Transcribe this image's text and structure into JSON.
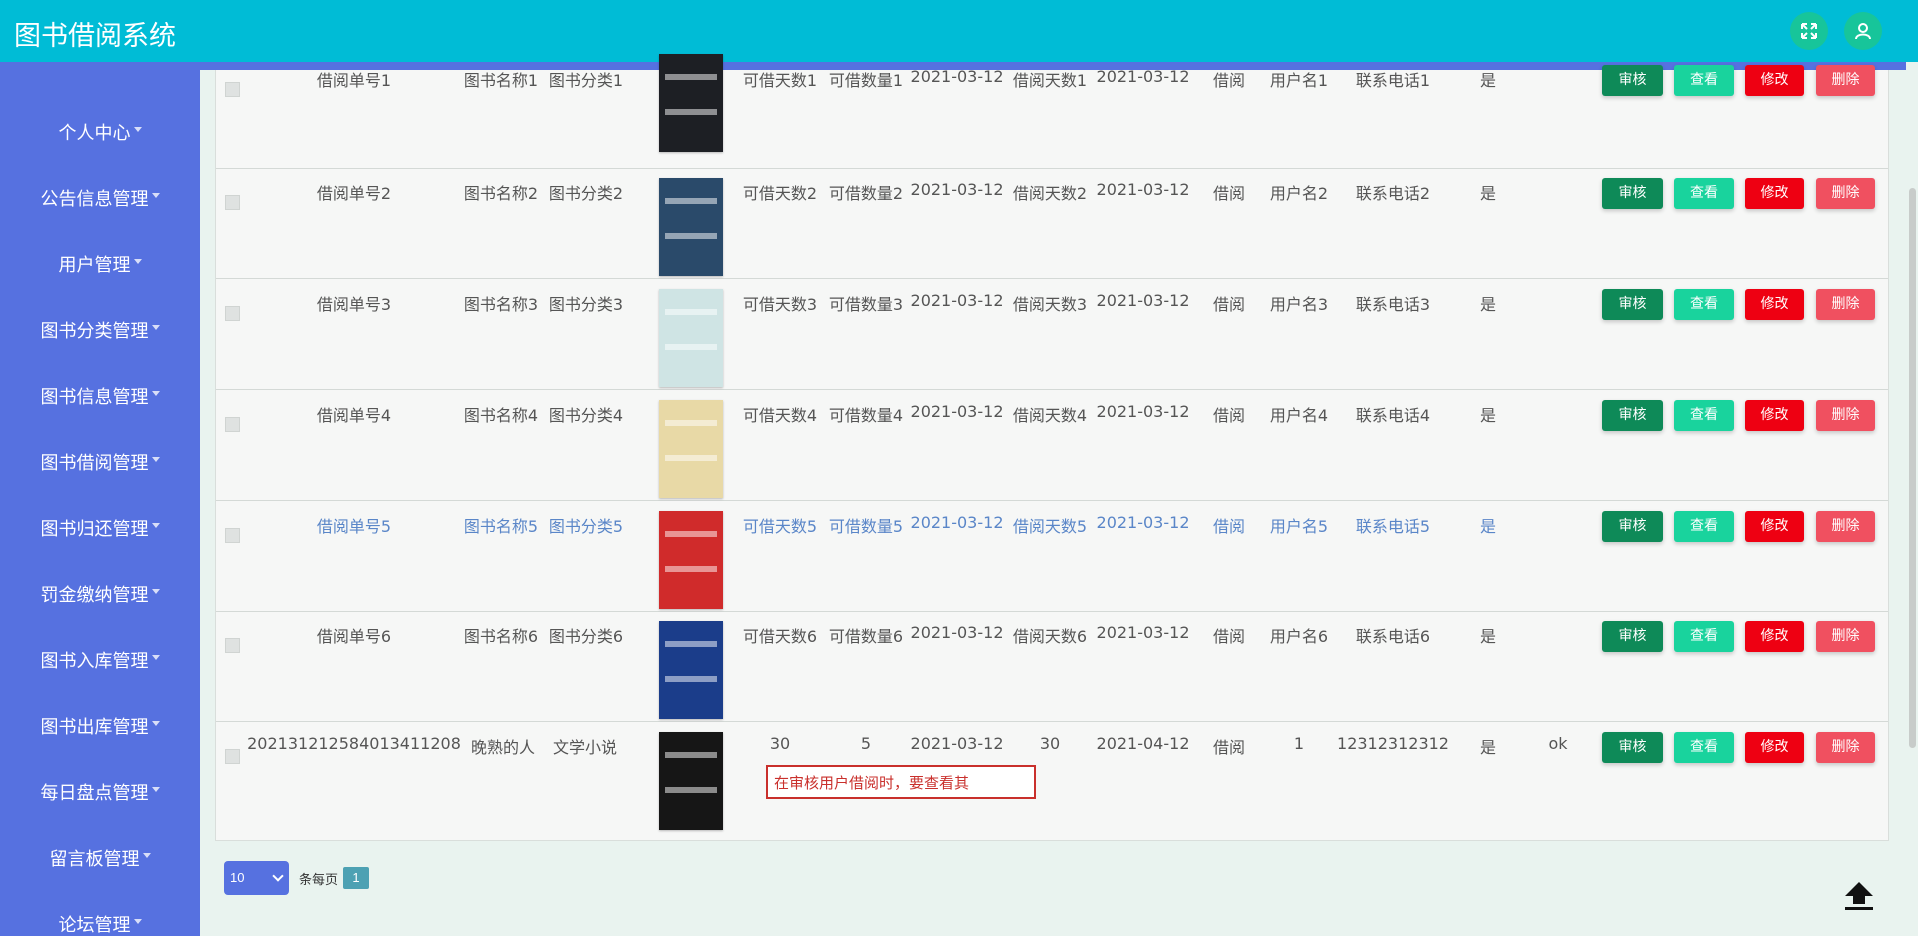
{
  "app": {
    "title": "图书借阅系统"
  },
  "header": {
    "icons": [
      "expand-icon",
      "user-icon"
    ],
    "accent": "#00bcd6"
  },
  "sidebar": {
    "items": [
      {
        "label": "个人中心"
      },
      {
        "label": "公告信息管理"
      },
      {
        "label": "用户管理"
      },
      {
        "label": "图书分类管理"
      },
      {
        "label": "图书信息管理"
      },
      {
        "label": "图书借阅管理"
      },
      {
        "label": "图书归还管理"
      },
      {
        "label": "罚金缴纳管理"
      },
      {
        "label": "图书入库管理"
      },
      {
        "label": "图书出库管理"
      },
      {
        "label": "每日盘点管理"
      },
      {
        "label": "留言板管理"
      },
      {
        "label": "论坛管理"
      }
    ]
  },
  "actions": {
    "audit": "审核",
    "view": "查看",
    "edit": "修改",
    "delete": "删除"
  },
  "rows": [
    {
      "no": "借阅单号1",
      "name": "图书名称1",
      "cat": "图书分类1",
      "days_avail": "可借天数1",
      "qty": "可借数量1",
      "date1": "2021-03-12",
      "days_borrow": "借阅天数1",
      "date2": "2021-03-12",
      "status": "借阅",
      "user": "用户名1",
      "phone": "联系电话1",
      "flag": "是",
      "remark": "",
      "cover_color": "#1d1f24"
    },
    {
      "no": "借阅单号2",
      "name": "图书名称2",
      "cat": "图书分类2",
      "days_avail": "可借天数2",
      "qty": "可借数量2",
      "date1": "2021-03-12",
      "days_borrow": "借阅天数2",
      "date2": "2021-03-12",
      "status": "借阅",
      "user": "用户名2",
      "phone": "联系电话2",
      "flag": "是",
      "remark": "",
      "cover_color": "#2a4a6a"
    },
    {
      "no": "借阅单号3",
      "name": "图书名称3",
      "cat": "图书分类3",
      "days_avail": "可借天数3",
      "qty": "可借数量3",
      "date1": "2021-03-12",
      "days_borrow": "借阅天数3",
      "date2": "2021-03-12",
      "status": "借阅",
      "user": "用户名3",
      "phone": "联系电话3",
      "flag": "是",
      "remark": "",
      "cover_color": "#cfe4e4"
    },
    {
      "no": "借阅单号4",
      "name": "图书名称4",
      "cat": "图书分类4",
      "days_avail": "可借天数4",
      "qty": "可借数量4",
      "date1": "2021-03-12",
      "days_borrow": "借阅天数4",
      "date2": "2021-03-12",
      "status": "借阅",
      "user": "用户名4",
      "phone": "联系电话4",
      "flag": "是",
      "remark": "",
      "cover_color": "#e8d9a6"
    },
    {
      "no": "借阅单号5",
      "name": "图书名称5",
      "cat": "图书分类5",
      "days_avail": "可借天数5",
      "qty": "可借数量5",
      "date1": "2021-03-12",
      "days_borrow": "借阅天数5",
      "date2": "2021-03-12",
      "status": "借阅",
      "user": "用户名5",
      "phone": "联系电话5",
      "flag": "是",
      "remark": "",
      "cover_color": "#d02b2b"
    },
    {
      "no": "借阅单号6",
      "name": "图书名称6",
      "cat": "图书分类6",
      "days_avail": "可借天数6",
      "qty": "可借数量6",
      "date1": "2021-03-12",
      "days_borrow": "借阅天数6",
      "date2": "2021-03-12",
      "status": "借阅",
      "user": "用户名6",
      "phone": "联系电话6",
      "flag": "是",
      "remark": "",
      "cover_color": "#1b3d8a"
    },
    {
      "no": "202131212584013411208",
      "name": "晚熟的人",
      "cat": "文学小说",
      "days_avail": "30",
      "qty": "5",
      "date1": "2021-03-12",
      "days_borrow": "30",
      "date2": "2021-04-12",
      "status": "借阅",
      "user": "1",
      "phone": "12312312312",
      "flag": "是",
      "remark": "ok",
      "cover_color": "#161616"
    }
  ],
  "tooltip": {
    "text": "在审核用户借阅时，要查看其"
  },
  "pagination": {
    "page_size": "10",
    "per_page_label": "条每页",
    "current_page": "1"
  }
}
